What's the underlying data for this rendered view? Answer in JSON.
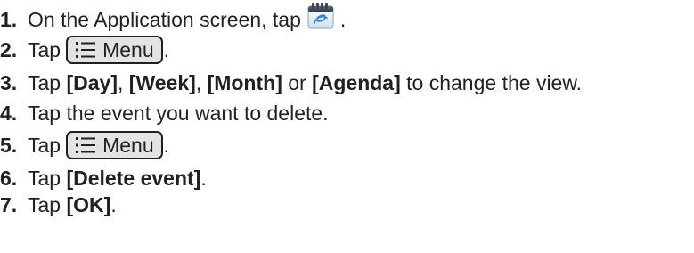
{
  "steps": [
    {
      "number": "1.",
      "text_before": "On the Application screen, tap",
      "text_after": ".",
      "icon": "calendar-app-icon"
    },
    {
      "number": "2.",
      "text_before": "Tap",
      "key_label": "Menu",
      "text_after": "."
    },
    {
      "number": "3.",
      "t1": "Tap ",
      "k1": "[Day]",
      "t2": ", ",
      "k2": "[Week]",
      "t3": ", ",
      "k3": "[Month]",
      "t4": " or ",
      "k4": "[Agenda]",
      "t5": " to change the view."
    },
    {
      "number": "4.",
      "text": "Tap the event you want to delete."
    },
    {
      "number": "5.",
      "text_before": "Tap",
      "key_label": "Menu",
      "text_after": "."
    },
    {
      "number": "6.",
      "t1": "Tap ",
      "k1": "[Delete event]",
      "t2": "."
    },
    {
      "number": "7.",
      "t1": "Tap ",
      "k1": "[OK]",
      "t2": "."
    }
  ],
  "colors": {
    "text": "#231f20",
    "key_background": "#e3e3e3",
    "icon_blue": "#2d7fc4"
  }
}
